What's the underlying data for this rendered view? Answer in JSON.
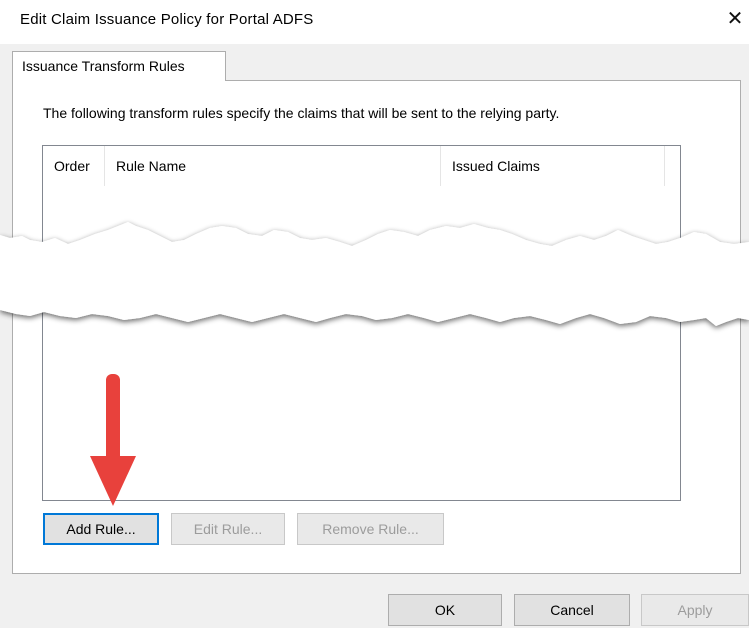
{
  "dialog": {
    "title": "Edit Claim Issuance Policy for Portal ADFS",
    "close_glyph": "✕"
  },
  "tabs": [
    {
      "label": "Issuance Transform Rules",
      "selected": true
    }
  ],
  "panel": {
    "description": "The following transform rules specify the claims that will be sent to the relying party.",
    "columns": [
      {
        "label": "Order"
      },
      {
        "label": "Rule Name"
      },
      {
        "label": "Issued Claims"
      }
    ],
    "rows": []
  },
  "rule_buttons": {
    "add": {
      "label": "Add Rule...",
      "enabled": true
    },
    "edit": {
      "label": "Edit Rule...",
      "enabled": false
    },
    "remove": {
      "label": "Remove Rule...",
      "enabled": false
    }
  },
  "footer_buttons": {
    "ok": {
      "label": "OK",
      "enabled": true
    },
    "cancel": {
      "label": "Cancel",
      "enabled": true
    },
    "apply": {
      "label": "Apply",
      "enabled": false
    }
  },
  "annotations": {
    "arrow_color": "#e8413c",
    "focus_color": "#0078d7"
  }
}
